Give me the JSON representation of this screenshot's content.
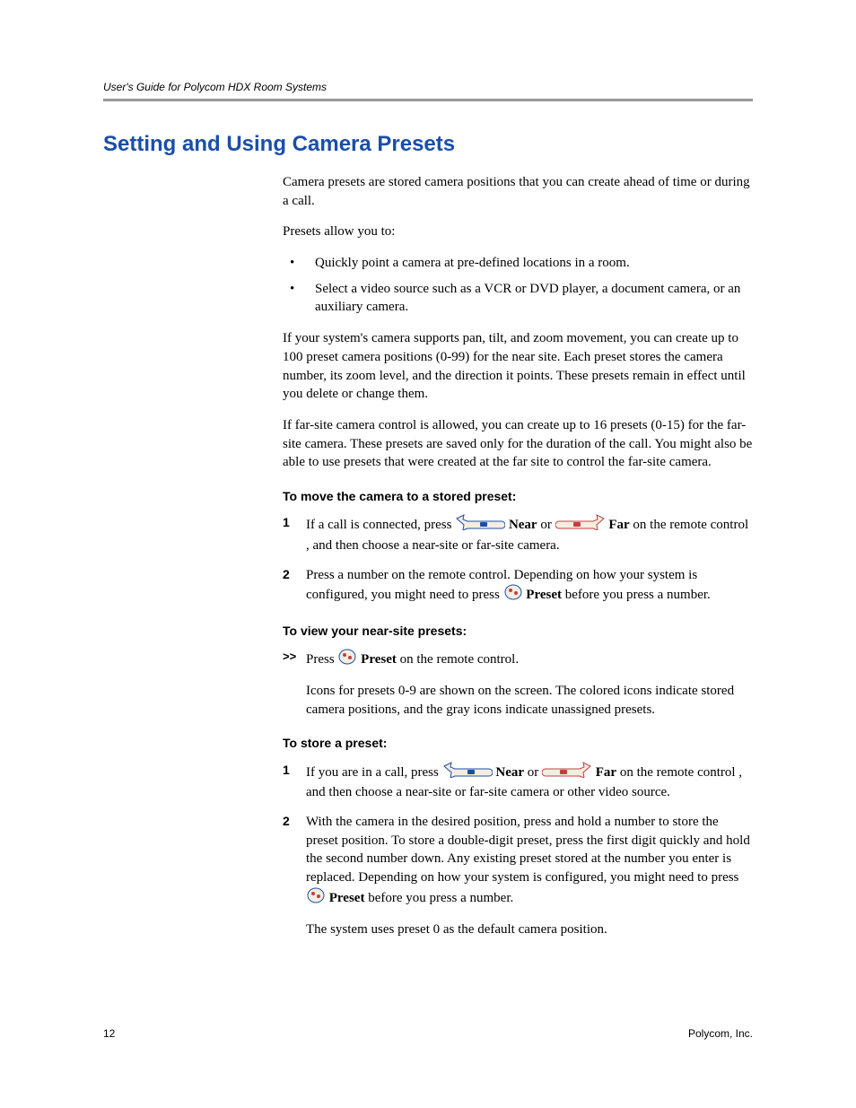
{
  "header": {
    "running_head": "User's Guide for Polycom HDX Room Systems"
  },
  "section": {
    "title": "Setting and Using Camera Presets",
    "intro": "Camera presets are stored camera positions that you can create ahead of time or during a call.",
    "presets_allow": "Presets allow you to:",
    "bullets": [
      "Quickly point a camera at pre-defined locations in a room.",
      "Select a video source such as a VCR or DVD player, a document camera, or an auxiliary camera."
    ],
    "para_pan": "If your system's camera supports pan, tilt, and zoom movement, you can create up to 100 preset camera positions (0-99) for the near site. Each preset stores the camera number, its zoom level, and the direction it points. These presets remain in effect until you delete or change them.",
    "para_far": "If far-site camera control is allowed, you can create up to 16 presets (0-15) for the far-site camera. These presets are saved only for the duration of the call. You might also be able to use presets that were created at the far site to control the far-site camera.",
    "move": {
      "heading": "To move the camera to a stored preset:",
      "step1_a": "If a call is connected, press ",
      "step1_b": " or ",
      "step1_c": " on the remote control , and then choose a near-site or far-site camera.",
      "near": "Near",
      "far": "Far",
      "step2_a": "Press a number on the remote control. Depending on how your system is configured, you might need to press ",
      "step2_b": " before you press a number.",
      "preset": "Preset"
    },
    "view": {
      "heading": "To view your near-site presets:",
      "arrow": ">>",
      "line_a": "Press ",
      "line_b": " on the remote control.",
      "preset": "Preset",
      "para": "Icons for presets 0-9 are shown on the screen. The colored icons indicate stored camera positions, and the gray icons indicate unassigned presets."
    },
    "store": {
      "heading": "To store a preset:",
      "step1_a": "If you are in a call, press ",
      "step1_b": " or ",
      "step1_c": " on the remote control , and then choose a near-site or far-site camera or other video source.",
      "near": "Near",
      "far": "Far",
      "step2_a": "With the camera in the desired position, press and hold a number to store the preset position. To store a double-digit preset, press the first digit quickly and hold the second number down. Any existing preset stored at the number you enter is replaced. Depending on how your system is configured, you might need to press ",
      "step2_b": " before you press a number.",
      "preset": "Preset",
      "trail": "The system uses preset 0 as the default camera position."
    }
  },
  "footer": {
    "page": "12",
    "company": "Polycom, Inc."
  }
}
